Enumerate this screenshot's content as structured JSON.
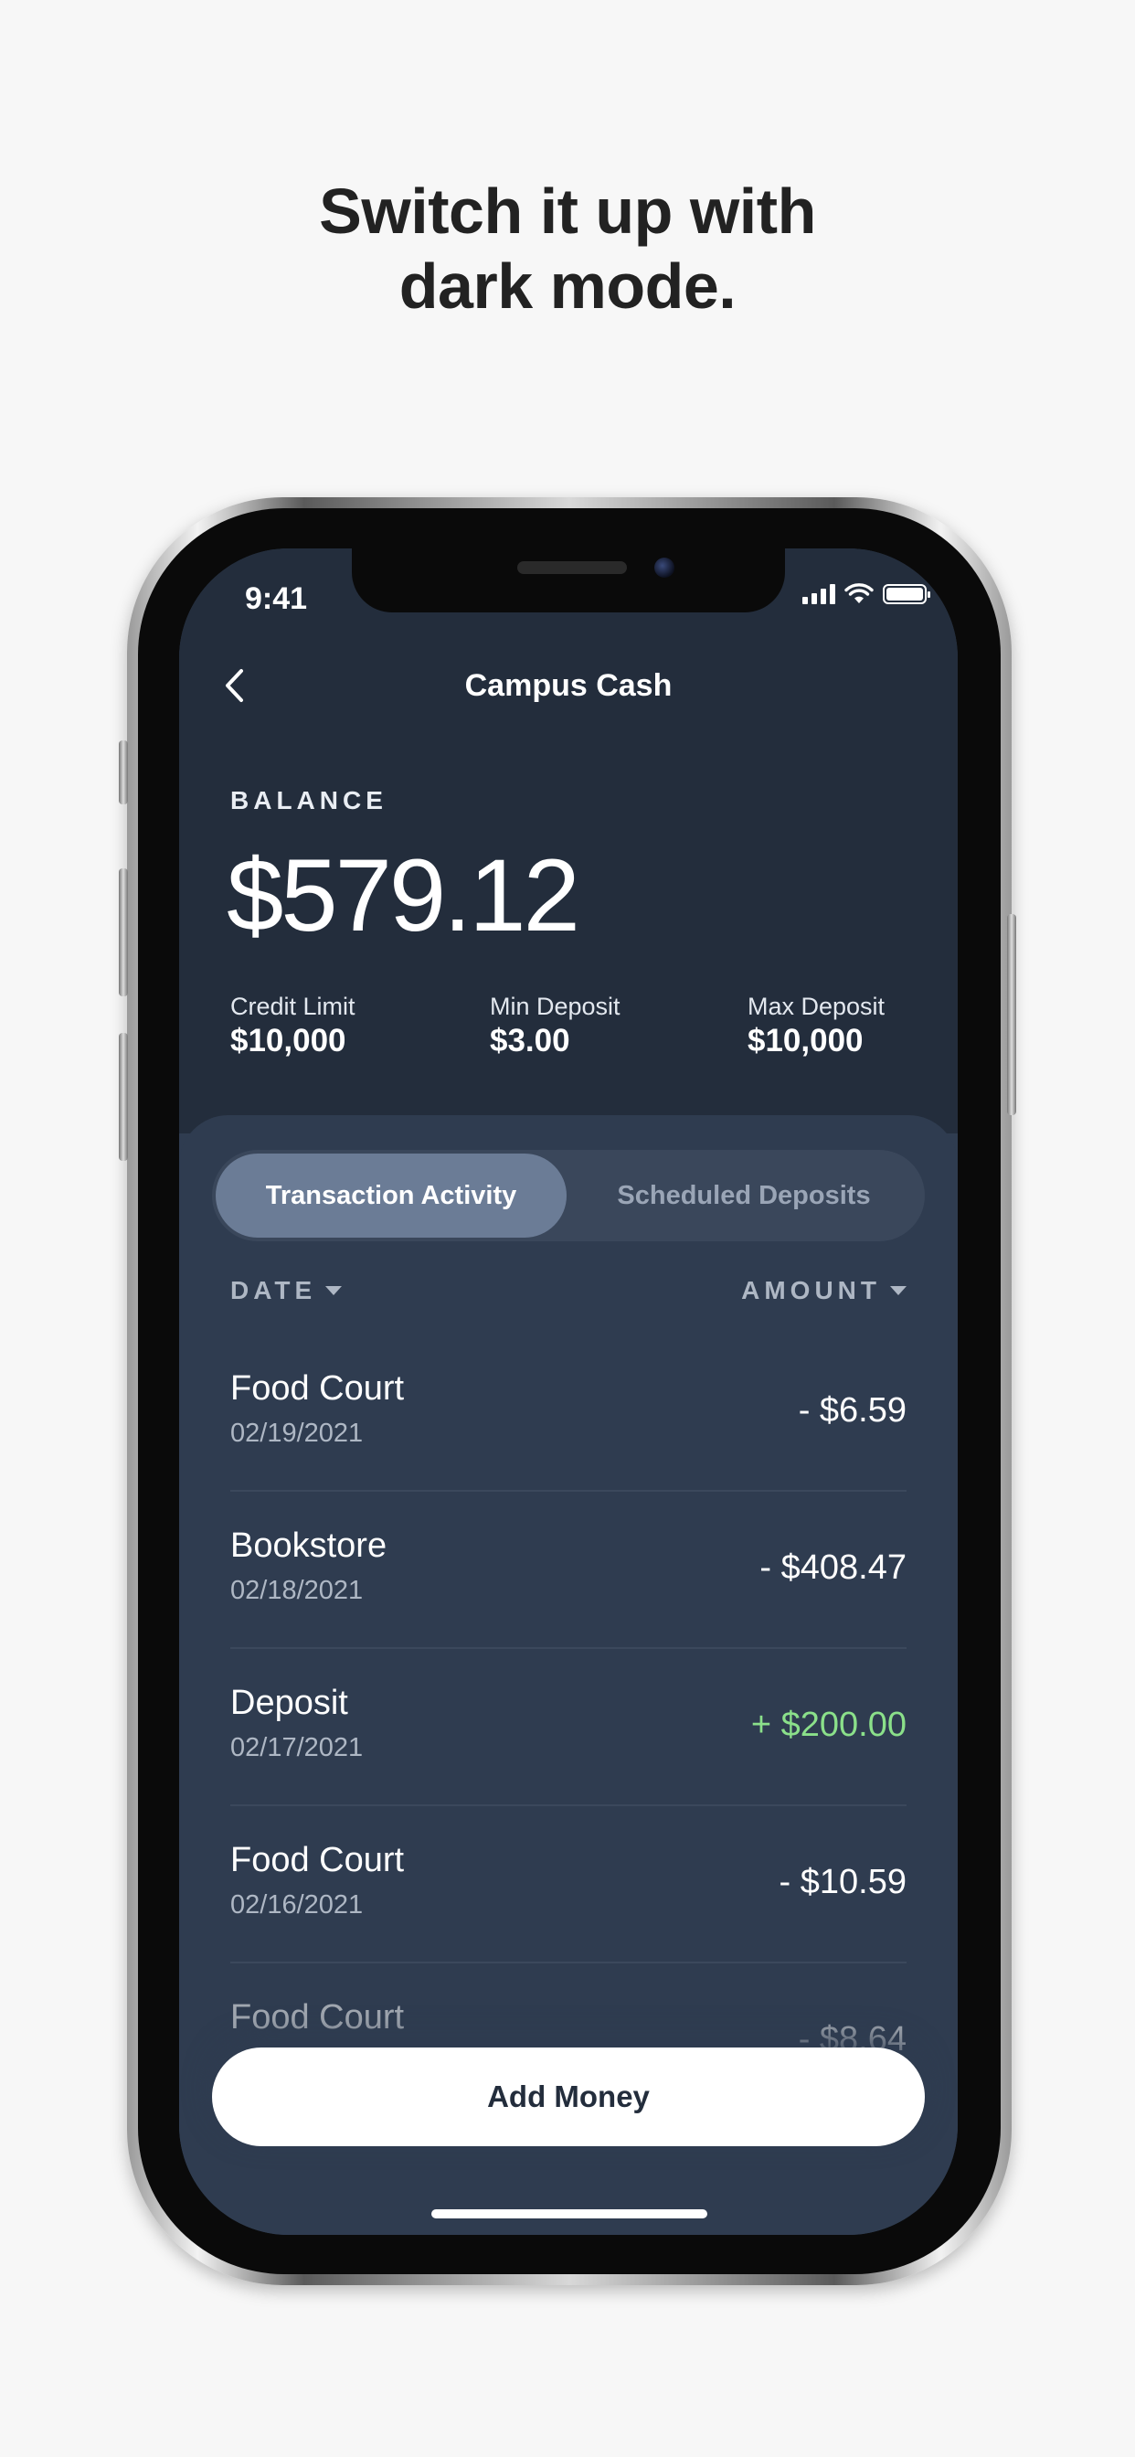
{
  "promo": {
    "headline_line1": "Switch it up with",
    "headline_line2": "dark mode."
  },
  "status_bar": {
    "time": "9:41",
    "icons": [
      "signal-icon",
      "wifi-icon",
      "battery-icon"
    ]
  },
  "nav": {
    "back_icon": "chevron-left-icon",
    "title": "Campus Cash"
  },
  "balance": {
    "label": "BALANCE",
    "amount": "$579.12",
    "stats": [
      {
        "label": "Credit Limit",
        "value": "$10,000"
      },
      {
        "label": "Min Deposit",
        "value": "$3.00"
      },
      {
        "label": "Max Deposit",
        "value": "$10,000"
      }
    ]
  },
  "tabs": [
    {
      "label": "Transaction Activity",
      "selected": true
    },
    {
      "label": "Scheduled Deposits",
      "selected": false
    }
  ],
  "columns": {
    "date": "DATE",
    "amount": "AMOUNT"
  },
  "transactions": [
    {
      "name": "Food Court",
      "date": "02/19/2021",
      "amount": "- $6.59"
    },
    {
      "name": "Bookstore",
      "date": "02/18/2021",
      "amount": "- $408.47"
    },
    {
      "name": "Deposit",
      "date": "02/17/2021",
      "amount": "+ $200.00"
    },
    {
      "name": "Food Court",
      "date": "02/16/2021",
      "amount": "- $10.59"
    },
    {
      "name": "Food Court",
      "date": "",
      "amount": "- $8.64"
    }
  ],
  "add_money_label": "Add Money",
  "colors": {
    "background": "#f7f7f7",
    "screen_top": "#232d3c",
    "panel": "#2f3c50",
    "active_tab": "#6b7c96",
    "positive_amount": "#8be08a",
    "button": "#ffffff"
  }
}
